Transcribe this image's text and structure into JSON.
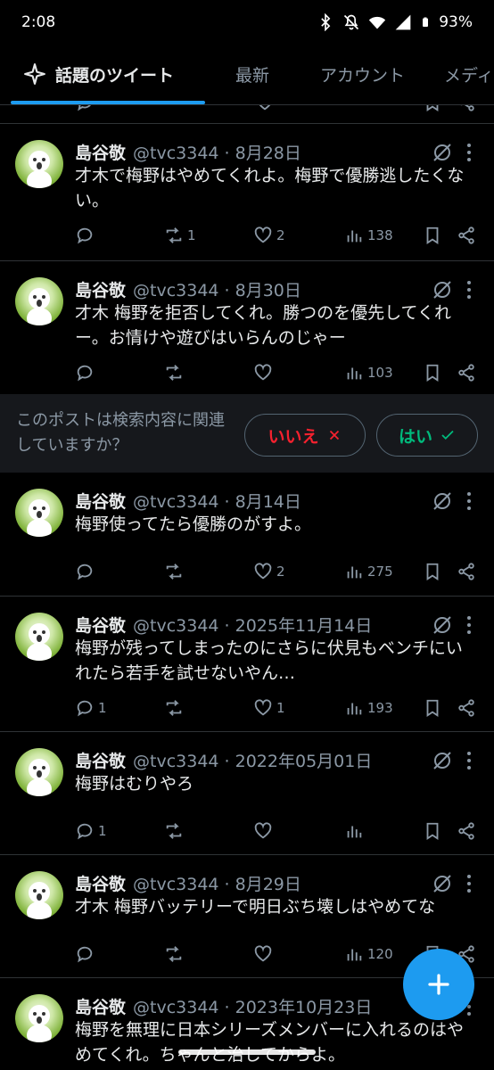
{
  "status": {
    "time": "2:08",
    "battery": "93%"
  },
  "tabs": [
    {
      "label": "話題のツイート",
      "icon": "sparkle-icon",
      "active": true
    },
    {
      "label": "最新"
    },
    {
      "label": "アカウント"
    },
    {
      "label": "メディ"
    }
  ],
  "relevance": {
    "question": "このポストは検索内容に関連していますか？",
    "no": "いいえ",
    "yes": "はい"
  },
  "tweets": [
    {
      "name": "島谷敬",
      "meta": "@tvc3344 · 8月28日",
      "text": "才木で梅野はやめてくれよ。梅野で優勝逃したくない。",
      "replies": "",
      "reposts": "1",
      "likes": "2",
      "views": "138"
    },
    {
      "name": "島谷敬",
      "meta": "@tvc3344 · 8月30日",
      "text": "才木 梅野を拒否してくれ。勝つのを優先してくれー。お情けや遊びはいらんのじゃー",
      "replies": "",
      "reposts": "",
      "likes": "",
      "views": "103"
    },
    {
      "name": "島谷敬",
      "meta": "@tvc3344 · 8月14日",
      "text": "梅野使ってたら優勝のがすよ。",
      "replies": "",
      "reposts": "",
      "likes": "2",
      "views": "275"
    },
    {
      "name": "島谷敬",
      "meta": "@tvc3344 · 2025年11月14日",
      "text": "梅野が残ってしまったのにさらに伏見もベンチにいれたら若手を試せないやん…",
      "replies": "1",
      "reposts": "",
      "likes": "1",
      "views": "193"
    },
    {
      "name": "島谷敬",
      "meta": "@tvc3344 · 2022年05月01日",
      "text": "梅野はむりやろ",
      "replies": "1",
      "reposts": "",
      "likes": "",
      "views": ""
    },
    {
      "name": "島谷敬",
      "meta": "@tvc3344 · 8月29日",
      "text": "才木 梅野バッテリーで明日ぶち壊しはやめてな",
      "replies": "",
      "reposts": "",
      "likes": "",
      "views": "120"
    },
    {
      "name": "島谷敬",
      "meta": "@tvc3344 · 2023年10月23日",
      "text": "梅野を無理に日本シリーズメンバーに入れるのはやめてくれ。ちゃんと治してからよ。",
      "replies": "",
      "reposts": "",
      "likes": "",
      "views": ""
    }
  ],
  "fab": {
    "icon": "plus-icon"
  },
  "colors": {
    "accent": "#1d9bf0",
    "no": "#f4212e",
    "yes": "#00ba7c",
    "muted": "#8b98a5"
  }
}
